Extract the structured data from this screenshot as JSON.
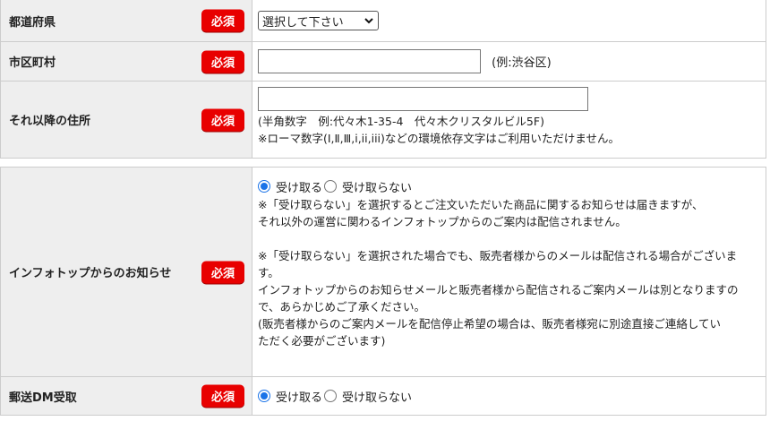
{
  "required_badge": "必須",
  "address": {
    "prefecture": {
      "label": "都道府県",
      "select_value": "選択して下さい"
    },
    "city": {
      "label": "市区町村",
      "hint": "(例:渋谷区)"
    },
    "street": {
      "label": "それ以降の住所",
      "hint_line1": "(半角数字　例:代々木1-35-4　代々木クリスタルビル5F)",
      "hint_line2": "※ローマ数字(Ⅰ,Ⅱ,Ⅲ,i,ii,iii)などの環境依存文字はご利用いただけません。"
    }
  },
  "notifications": {
    "infotop": {
      "label": "インフォトップからのお知らせ",
      "option_receive": "受け取る",
      "option_decline": "受け取らない",
      "selected": "receive",
      "notes": [
        "※「受け取らない」を選択するとご注文いただいた商品に関するお知らせは届きますが、",
        "それ以外の運営に関わるインフォトップからのご案内は配信されません。",
        "",
        "※「受け取らない」を選択された場合でも、販売者様からのメールは配信される場合がございま",
        "す。",
        "インフォトップからのお知らせメールと販売者様から配信されるご案内メールは別となりますの",
        "で、あらかじめご了承ください。",
        "(販売者様からのご案内メールを配信停止希望の場合は、販売者様宛に別途直接ご連絡してい",
        "ただく必要がございます)"
      ]
    },
    "dm": {
      "label": "郵送DM受取",
      "option_receive": "受け取る",
      "option_decline": "受け取らない",
      "selected": "receive"
    }
  },
  "colors": {
    "badge": "#e80000",
    "label_bg": "#eeeeee",
    "radio_accent": "#1a73e8"
  }
}
